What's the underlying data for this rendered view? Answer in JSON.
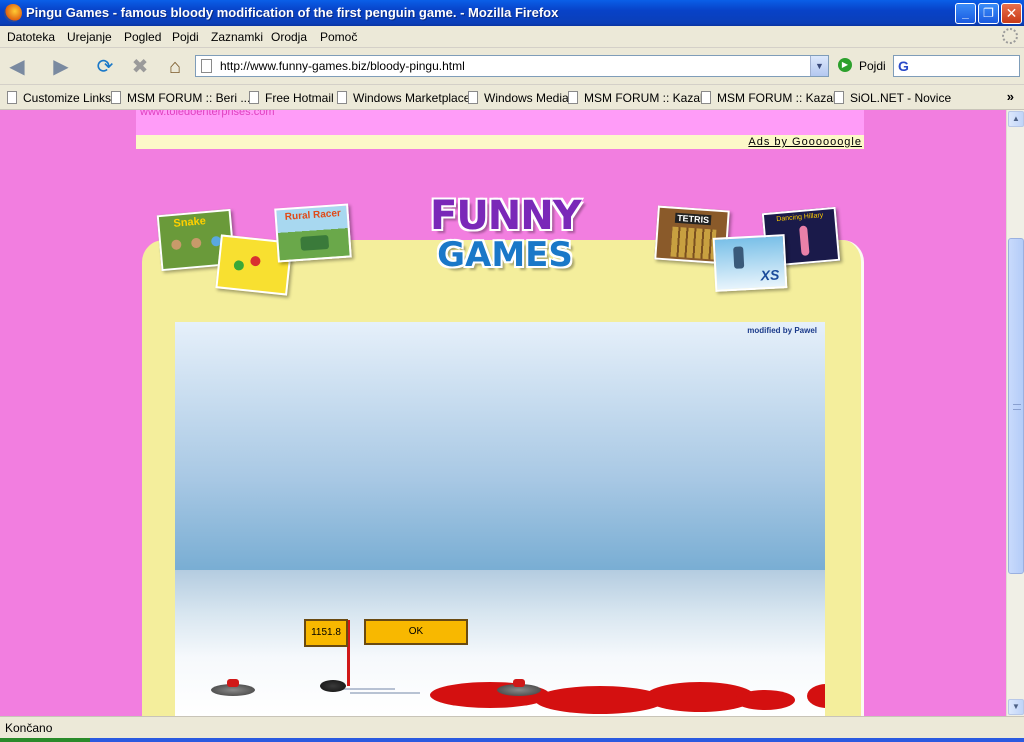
{
  "window": {
    "title": "Pingu Games - famous bloody modification of the first penguin game. - Mozilla Firefox",
    "min_label": "_",
    "max_label": "❐",
    "close_label": "✕"
  },
  "menu": {
    "items": [
      "Datoteka",
      "Urejanje",
      "Pogled",
      "Pojdi",
      "Zaznamki",
      "Orodja",
      "Pomoč"
    ]
  },
  "nav": {
    "back_icon": "◀",
    "forward_icon": "▶",
    "reload_icon": "⟳",
    "stop_icon": "✖",
    "home_icon": "⌂",
    "url": "http://www.funny-games.biz/bloody-pingu.html",
    "go_label": "Pojdi",
    "search_engine": "G"
  },
  "bookmarks": {
    "items": [
      "Customize Links",
      "MSM FORUM :: Beri ...",
      "Free Hotmail",
      "Windows Marketplace",
      "Windows Media",
      "MSM FORUM :: Kazalo",
      "MSM FORUM :: Kazalo",
      "SiOL.NET - Novice"
    ],
    "more": "»"
  },
  "page": {
    "ad_link": "www.toledoenterprises.com",
    "ads_by": "Ads by Goooooogle",
    "logo_top": "FUNNY",
    "logo_bottom": "GAMES",
    "thumb_labels": [
      "Snake",
      "Rural Racer",
      "TETRIS",
      "Dancing Hillary",
      "XS"
    ],
    "game": {
      "credit": "modified by Pawel",
      "score": "1151.8",
      "ok_label": "OK"
    }
  },
  "status": {
    "text": "Končano"
  },
  "colors": {
    "page_bg": "#f27ee0",
    "panel_bg": "#f4ee9c",
    "blood": "#d41010",
    "button": "#f8b800"
  }
}
